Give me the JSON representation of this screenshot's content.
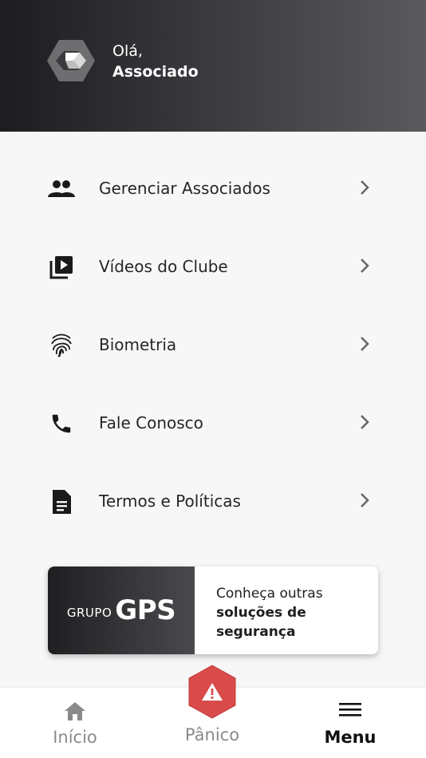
{
  "header": {
    "greeting": "Olá,",
    "user_name": "Associado"
  },
  "menu": {
    "items": [
      {
        "label": "Gerenciar Associados",
        "icon": "people-icon"
      },
      {
        "label": "Vídeos do Clube",
        "icon": "video-library-icon"
      },
      {
        "label": "Biometria",
        "icon": "fingerprint-icon"
      },
      {
        "label": "Fale Conosco",
        "icon": "phone-icon"
      },
      {
        "label": "Termos e Políticas",
        "icon": "document-icon"
      }
    ]
  },
  "banner": {
    "brand_prefix": "GRUPO",
    "brand_name": "GPS",
    "line1": "Conheça outras",
    "line2": "soluções de",
    "line3": "segurança"
  },
  "tabbar": {
    "inicio_label": "Início",
    "panico_label": "Pânico",
    "menu_label": "Menu",
    "active": "Menu"
  },
  "colors": {
    "panic_red": "#d94b4b",
    "header_dark": "#1d1d20",
    "text_dark": "#262626",
    "inactive_gray": "#8a8a8a"
  }
}
